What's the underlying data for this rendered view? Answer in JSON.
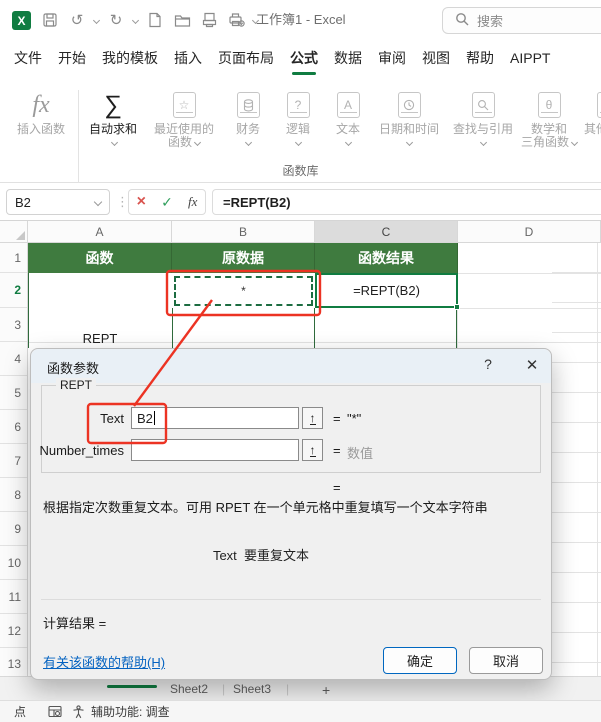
{
  "titlebar": {
    "title": "工作簿1 - Excel",
    "search_placeholder": "搜索"
  },
  "menu": {
    "tabs": [
      {
        "label": "文件"
      },
      {
        "label": "开始"
      },
      {
        "label": "我的模板"
      },
      {
        "label": "插入"
      },
      {
        "label": "页面布局"
      },
      {
        "label": "公式",
        "active": true
      },
      {
        "label": "数据"
      },
      {
        "label": "审阅"
      },
      {
        "label": "视图"
      },
      {
        "label": "帮助"
      },
      {
        "label": "AIPPT"
      }
    ]
  },
  "ribbon": {
    "insert_fn": {
      "glyph": "fx",
      "label": "插入函数"
    },
    "items": [
      {
        "line1": "自动求和",
        "line2": "",
        "glyph": "∑"
      },
      {
        "line1": "最近使用的",
        "line2": "函数",
        "glyph": "☆"
      },
      {
        "line1": "财务",
        "line2": "",
        "glyph": ""
      },
      {
        "line1": "逻辑",
        "line2": "",
        "glyph": "?"
      },
      {
        "line1": "文本",
        "line2": "",
        "glyph": "A"
      },
      {
        "line1": "日期和时间",
        "line2": "",
        "glyph": ""
      },
      {
        "line1": "查找与引用",
        "line2": "",
        "glyph": ""
      },
      {
        "line1": "数学和",
        "line2": "三角函数",
        "glyph": "θ"
      },
      {
        "line1": "其他函数",
        "line2": "",
        "glyph": "…"
      }
    ],
    "group_label": "函数库"
  },
  "formula_bar": {
    "name_box": "B2",
    "cancel_glyph": "×",
    "enter_glyph": "✓",
    "fx_glyph": "fx",
    "formula": "=REPT(B2)"
  },
  "grid": {
    "column_headers": [
      "A",
      "B",
      "C",
      "D"
    ],
    "row_headers": [
      "1",
      "2",
      "3",
      "4",
      "5",
      "6",
      "7",
      "8",
      "9",
      "10",
      "11",
      "12",
      "13"
    ],
    "header_row": {
      "a": "函数",
      "b": "原数据",
      "c": "函数结果"
    },
    "cells": {
      "b2": "*",
      "c2": "=REPT(B2)",
      "a3": "REPT"
    }
  },
  "dialog": {
    "title": "函数参数",
    "help_glyph": "?",
    "close_glyph": "✕",
    "function_name": "REPT",
    "collapse_glyph": "↑",
    "fields": [
      {
        "label": "Text",
        "value": "B2",
        "equals": "=",
        "result": "\"*\""
      },
      {
        "label": "Number_times",
        "value": "",
        "equals": "=",
        "result": "数值"
      }
    ],
    "equals_preview": "=",
    "description": "根据指定次数重复文本。可用 RPET 在一个单元格中重复填写一个文本字符串",
    "param_hint": "Text  要重复文本",
    "calc_result_label": "计算结果 =",
    "help_link": "有关该函数的帮助(H)",
    "ok_label": "确定",
    "cancel_label": "取消"
  },
  "sheet_tabs": {
    "tabs": [
      "Sheet2",
      "Sheet3"
    ],
    "add_label": "+"
  },
  "status_bar": {
    "mode": "点",
    "accessibility": "辅助功能: 调查"
  },
  "colors": {
    "excel_green": "#107C41",
    "header_fill": "#3F7B3F",
    "annotation_red": "#EC3323",
    "link_blue": "#0563C1",
    "ok_border": "#0067C0"
  }
}
